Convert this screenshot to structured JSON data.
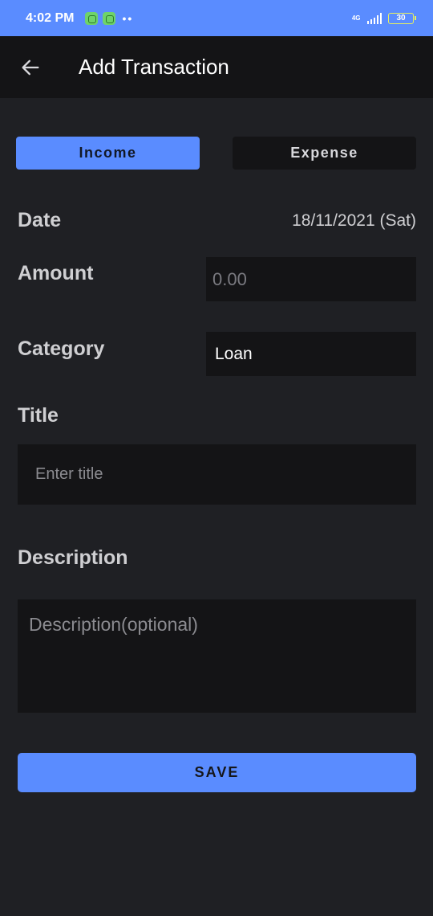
{
  "status_bar": {
    "time": "4:02 PM",
    "dots": "••",
    "network": "4G",
    "battery": "30"
  },
  "app_bar": {
    "title": "Add Transaction"
  },
  "tabs": [
    {
      "label": "Income",
      "selected": true
    },
    {
      "label": "Expense",
      "selected": false
    }
  ],
  "form": {
    "date_label": "Date",
    "date_value": "18/11/2021 (Sat)",
    "amount_label": "Amount",
    "amount_placeholder": "0.00",
    "category_label": "Category",
    "category_value": "Loan",
    "title_label": "Title",
    "title_placeholder": "Enter title",
    "description_label": "Description",
    "description_placeholder": "Description(optional)"
  },
  "actions": {
    "save_label": "SAVE"
  },
  "colors": {
    "accent": "#5a8cff",
    "background": "#1f2024",
    "surface": "#141416"
  },
  "icons": {
    "back": "arrow-left-icon"
  }
}
